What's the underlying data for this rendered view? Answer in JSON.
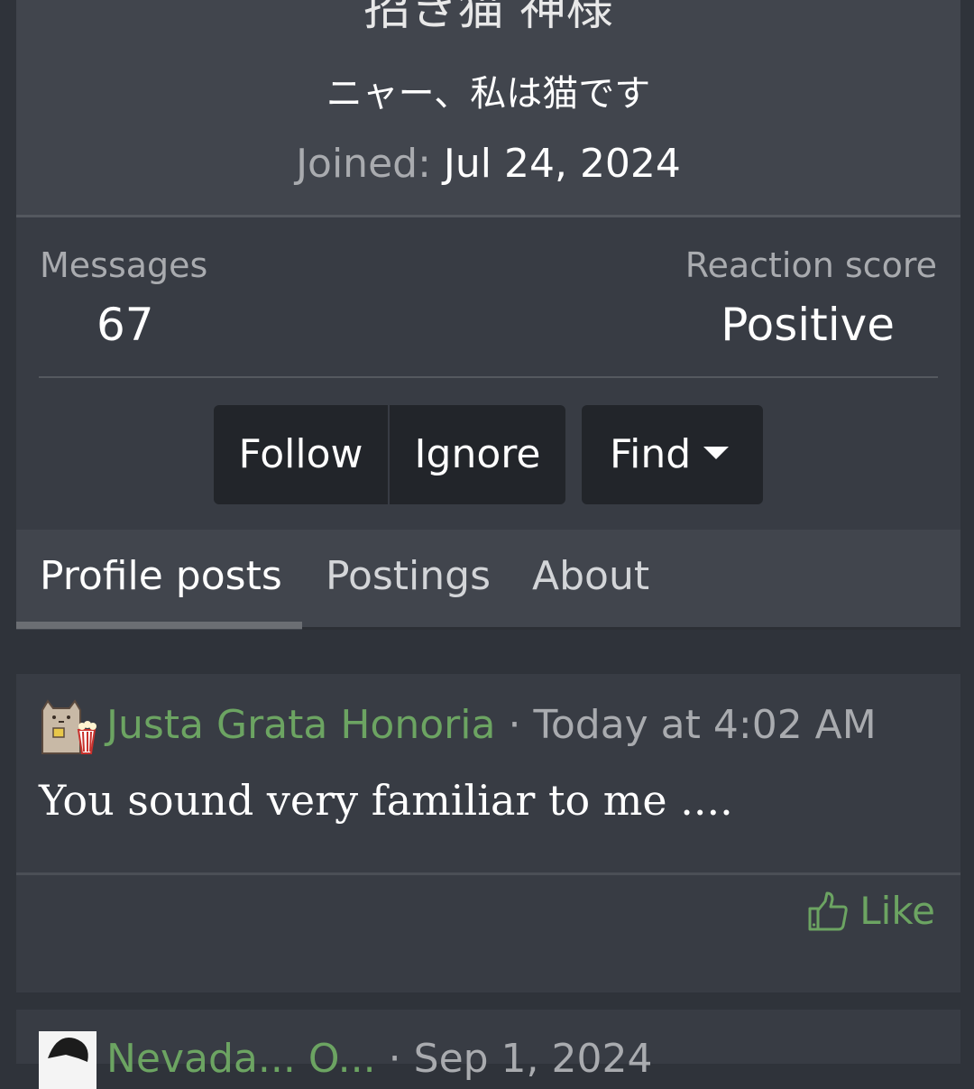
{
  "profile": {
    "username": "招き猫 神様",
    "user_title": "ニャー、私は猫です",
    "joined_label": "Joined:",
    "joined_value": "Jul 24, 2024"
  },
  "stats": {
    "messages_label": "Messages",
    "messages_value": "67",
    "reaction_label": "Reaction score",
    "reaction_value": "Positive"
  },
  "actions": {
    "follow": "Follow",
    "ignore": "Ignore",
    "find": "Find"
  },
  "tabs": [
    {
      "label": "Profile posts",
      "active": true
    },
    {
      "label": "Postings",
      "active": false
    },
    {
      "label": "About",
      "active": false
    }
  ],
  "posts": [
    {
      "author": "Justa Grata Honoria",
      "separator": "·",
      "time": "Today at 4:02 AM",
      "body": "You sound very familiar to me ....",
      "like_label": "Like"
    },
    {
      "author": "Nevada... O...",
      "separator": "·",
      "time": "Sep 1, 2024"
    }
  ],
  "colors": {
    "accent": "#6ca462",
    "card": "#383c44",
    "header": "#41454d",
    "button": "#22252a"
  }
}
